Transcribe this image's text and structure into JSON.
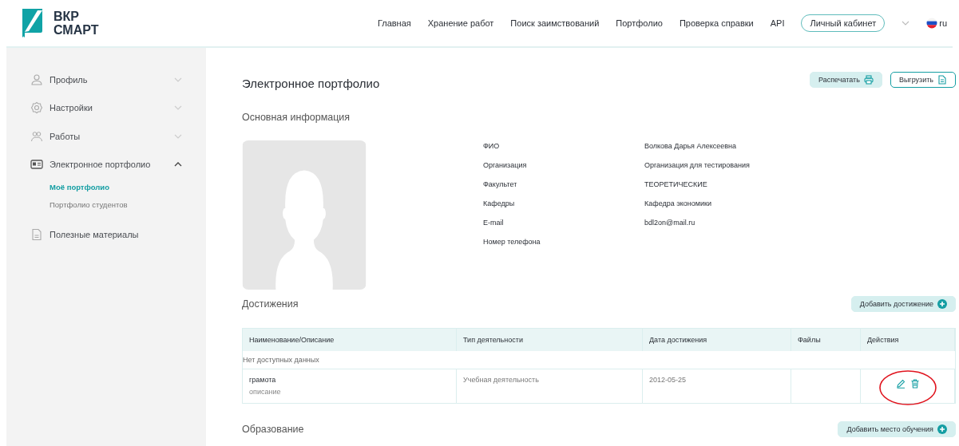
{
  "header": {
    "logo_line_1": "ВКР",
    "logo_line_2": "СМАРТ",
    "nav": [
      {
        "label": "Главная"
      },
      {
        "label": "Хранение работ"
      },
      {
        "label": "Поиск заимствований"
      },
      {
        "label": "Портфолио"
      },
      {
        "label": "Проверка справки"
      },
      {
        "label": "API"
      }
    ],
    "account_button": "Личный кабинет",
    "language": "ru"
  },
  "sidebar": {
    "items": [
      {
        "label": "Профиль",
        "kind": "group",
        "expanded": false
      },
      {
        "label": "Настройки",
        "kind": "group",
        "expanded": false
      },
      {
        "label": "Работы",
        "kind": "group",
        "expanded": false
      },
      {
        "label": "Электронное портфолио",
        "kind": "group",
        "expanded": true,
        "children": [
          {
            "label": "Моё портфолио",
            "selected": true
          },
          {
            "label": "Портфолио студентов",
            "selected": false
          }
        ]
      },
      {
        "label": "Полезные материалы",
        "kind": "link"
      }
    ]
  },
  "page": {
    "title": "Электронное портфолио",
    "print_button": "Распечатать",
    "export_button": "Выгрузить",
    "basic_info": {
      "heading": "Основная информация",
      "fields": [
        {
          "label": "ФИО",
          "value": "Волкова Дарья Алексеевна"
        },
        {
          "label": "Организация",
          "value": "Организация для тестирования"
        },
        {
          "label": "Факультет",
          "value": "ТЕОРЕТИЧЕСКИЕ"
        },
        {
          "label": "Кафедры",
          "value": "Кафедра экономики"
        },
        {
          "label": "E-mail",
          "value": "bdl2on@mail.ru"
        },
        {
          "label": "Номер телефона"
        }
      ]
    },
    "achievements": {
      "heading": "Достижения",
      "add_button": "Добавить достижение",
      "columns": [
        "Наименование/Описание",
        "Тип деятельности",
        "Дата достижения",
        "Файлы",
        "Действия"
      ],
      "empty_text": "Нет доступных данных",
      "rows": [
        {
          "name": "грамота",
          "description": "описание",
          "type": "Учебная деятельность",
          "date": "2012-05-25"
        }
      ]
    },
    "education": {
      "heading": "Образование",
      "add_button": "Добавить место обучения"
    }
  }
}
